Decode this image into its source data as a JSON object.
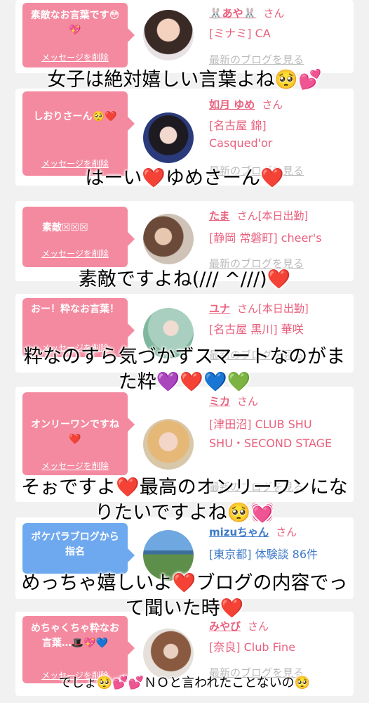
{
  "cards": [
    {
      "message": "素敵なお言葉です😳💖",
      "delete_label": "メッセージを削除",
      "name": "🐰あや🐰",
      "san": "さん",
      "status": "",
      "shop": "[ミナミ] CA",
      "blog_link": "最新のブログを見る",
      "bubble_color": "#f48aa0"
    },
    {
      "message": "しおりさーん🥺❤️",
      "delete_label": "メッセージを削除",
      "name": "如月 ゆめ",
      "san": "さん",
      "status": "",
      "shop": "[名古屋 錦] Casqued'or",
      "blog_link": "最新のブログを見る",
      "bubble_color": "#f48aa0"
    },
    {
      "message": "素敵☒☒☒",
      "delete_label": "メッセージを削除",
      "name": "たま",
      "san": "さん",
      "status": "[本日出勤]",
      "shop": "[静岡 常磐町] cheer's",
      "blog_link": "最新のブログを見る",
      "bubble_color": "#f48aa0"
    },
    {
      "message": "おー！粋なお言葉！",
      "delete_label": "メッセージを削除",
      "name": "ユナ",
      "san": "さん",
      "status": "[本日出勤]",
      "shop": "[名古屋 黒川] 華咲",
      "blog_link": "最新のブログを見る",
      "bubble_color": "#f48aa0"
    },
    {
      "message": "オンリーワンですね❤️",
      "delete_label": "メッセージを削除",
      "name": "ミカ",
      "san": "さん",
      "status": "",
      "shop": "[津田沼] CLUB SHU SHU・SECOND STAGE",
      "blog_link": "最新のブログを見る",
      "bubble_color": "#f48aa0"
    },
    {
      "message": "ポケパラブログから指名",
      "delete_label": "",
      "name": "mizuちゃん",
      "san": "さん",
      "status": "",
      "shop": "[東京都] 体験談 86件",
      "blog_link": "",
      "bubble_color": "#6ea9ef"
    },
    {
      "message": "めちゃくちゃ粋なお言葉…🎩💖💙",
      "delete_label": "メッセージを削除",
      "name": "みやび",
      "san": "さん",
      "status": "",
      "shop": "[奈良] Club Fine",
      "blog_link": "最新のブログを見る",
      "bubble_color": "#f48aa0"
    }
  ],
  "captions": [
    "女子は絶対嬉しい言葉よね🥺💕",
    "はーい❤️ゆめさーん❤️",
    "素敵ですよね(/// ^///)❤️",
    "粋なのすら気づかずスマートなのがまた粋💜❤️💙💚",
    "そぉですよ❤️最高のオンリーワンになりたいですよね🥺💓",
    "めっちゃ嬉しいよ❤️ブログの内容でって聞いた時❤️",
    "でしょ🥺💕💕ＮＯと言われたことないの🥺"
  ]
}
